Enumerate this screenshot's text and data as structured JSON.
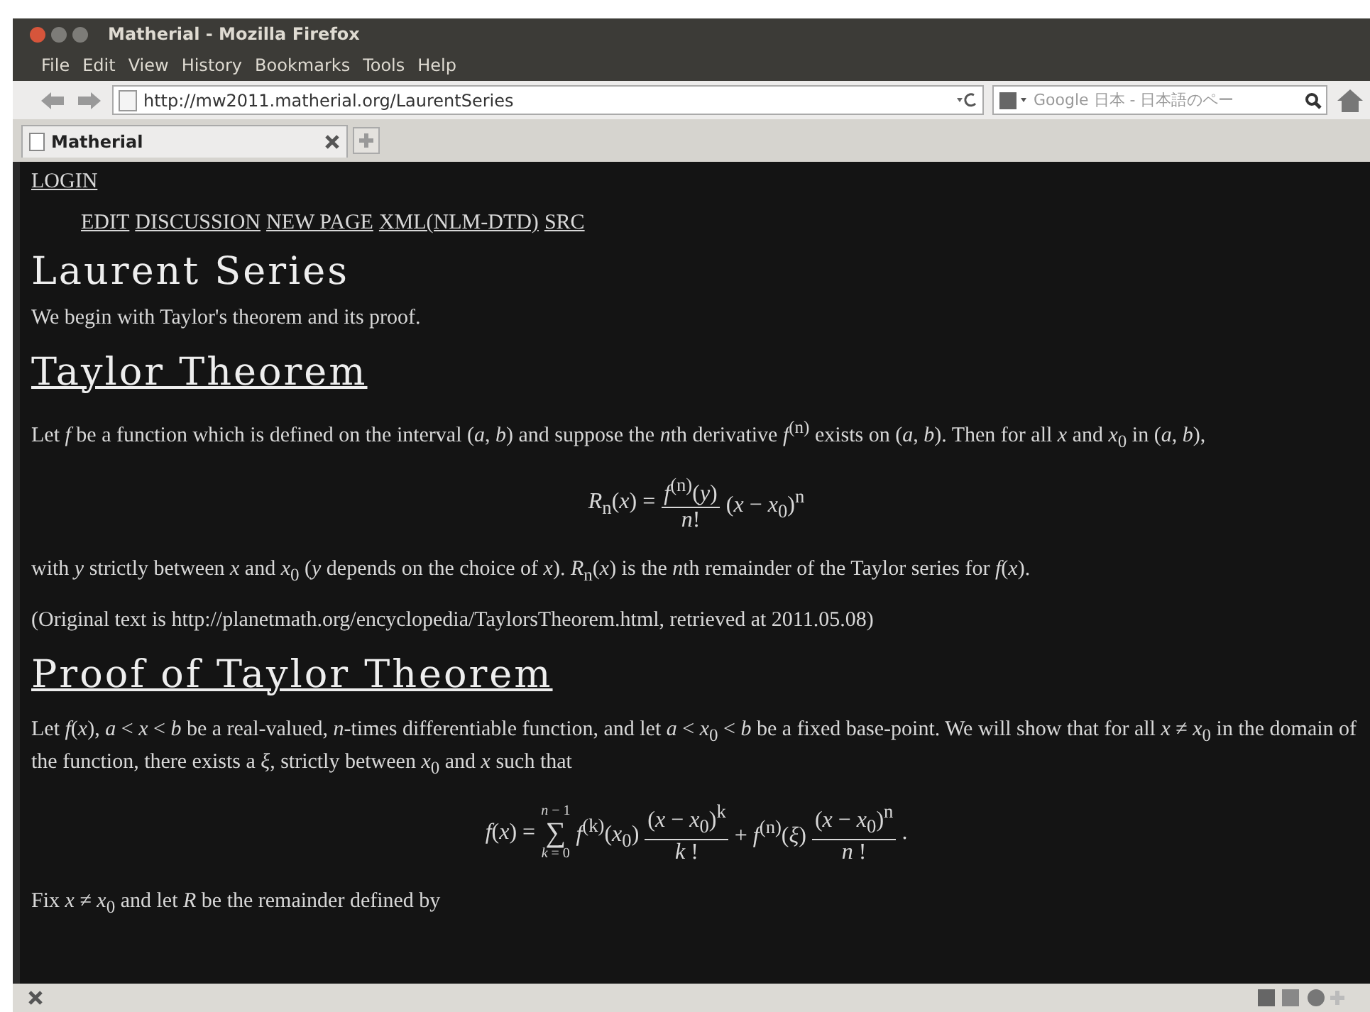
{
  "window": {
    "title": "Matherial - Mozilla Firefox"
  },
  "menu": [
    {
      "label": "File"
    },
    {
      "label": "Edit"
    },
    {
      "label": "View"
    },
    {
      "label": "History"
    },
    {
      "label": "Bookmarks"
    },
    {
      "label": "Tools"
    },
    {
      "label": "Help"
    }
  ],
  "address": {
    "value": "http://mw2011.matherial.org/LaurentSeries"
  },
  "search": {
    "placeholder": "Google 日本 - 日本語のペー"
  },
  "tabs": [
    {
      "label": "Matherial",
      "selected": true
    }
  ],
  "page": {
    "login": "LOGIN",
    "actions": [
      "EDIT",
      "DISCUSSION",
      "NEW PAGE",
      "XML(NLM-DTD)",
      "SRC"
    ],
    "title": "Laurent Series",
    "intro": "We begin with Taylor's theorem and its proof.",
    "sections": [
      {
        "heading": "Taylor Theorem",
        "blocks": [
          {
            "kind": "para",
            "text": [
              "Let *f* be a function which is defined on the interval (*a*, *b*) and suppose the *n*",
              "th derivative *f*$^{(n)}$ exists on (*a*, *b*). Then for all *x* and *x*$_{0}$ in (*a*, *b*),"
            ]
          },
          {
            "kind": "formula1",
            "lhs": "*R*$_{n}$(*x*) =",
            "num": "*f*$^{(n)}$(*y*)",
            "den": "*n*!",
            "tail": "(*x* − *x*$_{0}$)$^{n}$"
          },
          {
            "kind": "para",
            "text": [
              "with *y* strictly between *x* and *x*$_{0}$ (*y* depends on the choice of *x*). *R*$_{n}$(*x*) is the *n*",
              "th remainder of the Taylor series for *f*(*x*)."
            ]
          },
          {
            "kind": "para",
            "text": "(Original text is http://planetmath.org/encyclopedia/TaylorsTheorem.html, retrieved at 2011.05.08)"
          }
        ]
      },
      {
        "heading": "Proof of Taylor Theorem",
        "blocks": [
          {
            "kind": "para",
            "text": "Let *f*(*x*),  *a* < *x* < *b* be a real-valued, *n*-times differentiable function, and let *a* < *x*$_{0}$ < *b* be a fixed base-point. We will show that for all *x* ≠ *x*$_{0}$ in the domain of the function, there exists a *ξ*, strictly between *x*$_{0}$ and *x* such that"
          },
          {
            "kind": "formula2",
            "lhs": "*f*(*x*) =",
            "sum_top": "*n* − 1",
            "sigma": "∑",
            "sum_bottom": "*k* = 0",
            "term": "*f*$^{(k)}$(*x*$_{0}$)",
            "num1": "(*x* − *x*$_{0}$)$^{k}$",
            "den1": "*k* !",
            "mid": "+ *f*$^{(n)}$(*ξ*)",
            "num2": "(*x* − *x*$_{0}$)$^{n}$",
            "den2": "*n* !",
            "end": "."
          },
          {
            "kind": "para",
            "text": "Fix *x* ≠ *x*$_{0}$ and let *R* be the remainder defined by"
          }
        ]
      }
    ]
  }
}
